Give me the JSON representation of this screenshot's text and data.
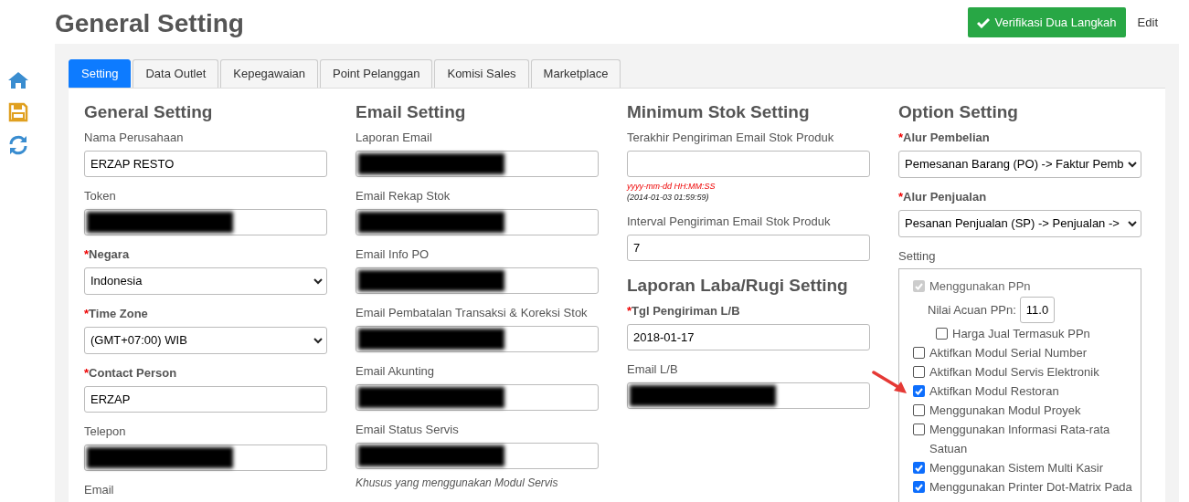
{
  "page_title": "General Setting",
  "header_actions": {
    "verify_button": "Verifikasi Dua Langkah",
    "edit_link": "Edit"
  },
  "side_toolbar": [
    {
      "kind": "home"
    },
    {
      "kind": "save"
    },
    {
      "kind": "refresh"
    }
  ],
  "tabs": [
    {
      "label": "Setting",
      "selected": true
    },
    {
      "label": "Data Outlet",
      "selected": false
    },
    {
      "label": "Kepegawaian",
      "selected": false
    },
    {
      "label": "Point Pelanggan",
      "selected": false
    },
    {
      "label": "Komisi Sales",
      "selected": false
    },
    {
      "label": "Marketplace",
      "selected": false
    }
  ],
  "columns": [
    {
      "sections": [
        {
          "title": "General Setting",
          "fields": [
            {
              "label": "Nama Perusahaan",
              "kind": "input",
              "value": "ERZAP RESTO"
            },
            {
              "label": "Token",
              "kind": "input",
              "redacted": true
            },
            {
              "label": "Negara",
              "required_mark": "*",
              "kind": "select",
              "value": "Indonesia"
            },
            {
              "label": "Time Zone",
              "required_mark": "*",
              "kind": "select",
              "value": "(GMT+07:00) WIB"
            },
            {
              "label": "Contact Person",
              "required_mark": "*",
              "kind": "input",
              "value": "ERZAP"
            },
            {
              "label": "Telepon",
              "kind": "input",
              "redacted": true
            },
            {
              "label": "Email",
              "kind": "input"
            }
          ]
        }
      ]
    },
    {
      "sections": [
        {
          "title": "Email Setting",
          "fields": [
            {
              "label": "Laporan Email",
              "kind": "input",
              "redacted": true
            },
            {
              "label": "Email Rekap Stok",
              "kind": "input",
              "redacted": true
            },
            {
              "label": "Email Info PO",
              "kind": "input",
              "redacted": true
            },
            {
              "label": "Email Pembatalan Transaksi & Koreksi Stok",
              "kind": "input",
              "redacted": true
            },
            {
              "label": "Email Akunting",
              "kind": "input",
              "redacted": true
            },
            {
              "label": "Email Status Servis",
              "kind": "input",
              "redacted": true,
              "note": "Khusus yang menggunakan Modul Servis"
            }
          ]
        }
      ]
    },
    {
      "sections": [
        {
          "title": "Minimum Stok Setting",
          "fields": [
            {
              "label": "Terakhir Pengiriman Email Stok Produk",
              "kind": "input",
              "format_hint": "yyyy-mm-dd HH:MM:SS",
              "example_hint": "(2014-01-03 01:59:59)"
            },
            {
              "label": "Interval Pengiriman Email Stok Produk",
              "kind": "input",
              "value": "7"
            }
          ]
        },
        {
          "title": "Laporan Laba/Rugi Setting",
          "fields": [
            {
              "label": "Tgl Pengiriman L/B",
              "required_mark": "*",
              "kind": "input",
              "value": "2018-01-17"
            },
            {
              "label": "Email L/B",
              "kind": "input",
              "redacted": true
            }
          ]
        }
      ]
    }
  ],
  "option_setting": {
    "title": "Option Setting",
    "selects": [
      {
        "label": "Alur Pembelian",
        "required_mark": "*",
        "value": "Pemesanan Barang (PO) -> Faktur Pemb"
      },
      {
        "label": "Alur Penjualan",
        "required_mark": "*",
        "value": "Pesanan Penjualan (SP) -> Penjualan ->"
      }
    ],
    "setting_label": "Setting",
    "settings": [
      {
        "kind": "checkbox",
        "label": "Menggunakan PPn",
        "checked": true,
        "disabled": true,
        "children": [
          {
            "kind": "number",
            "label": "Nilai Acuan PPn:",
            "value": "11.0"
          },
          {
            "kind": "checkbox",
            "label": "Harga Jual Termasuk PPn",
            "checked": false,
            "disabled": false
          }
        ]
      },
      {
        "kind": "checkbox",
        "label": "Aktifkan Modul Serial Number",
        "checked": false,
        "disabled": false
      },
      {
        "kind": "checkbox",
        "label": "Aktifkan Modul Servis Elektronik",
        "checked": false,
        "disabled": false
      },
      {
        "kind": "checkbox",
        "label": "Aktifkan Modul Restoran",
        "checked": true,
        "disabled": false
      },
      {
        "kind": "checkbox",
        "label": "Menggunakan Modul Proyek",
        "checked": false,
        "disabled": false
      },
      {
        "kind": "checkbox",
        "label": "Menggunakan Informasi Rata-rata Satuan",
        "checked": false,
        "disabled": false
      },
      {
        "kind": "checkbox",
        "label": "Menggunakan Sistem Multi Kasir",
        "checked": true,
        "disabled": false
      },
      {
        "kind": "checkbox",
        "label": "Menggunakan Printer Dot-Matrix Pada",
        "checked": true,
        "disabled": false
      }
    ]
  }
}
